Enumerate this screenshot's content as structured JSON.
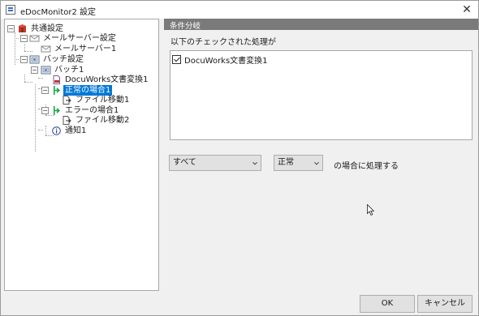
{
  "window": {
    "title": "eDocMonitor2 設定",
    "close_glyph": "✕"
  },
  "tree": {
    "nodes": [
      {
        "label": "共通設定",
        "icon": "settings-box-icon"
      },
      {
        "label": "メールサーバー設定",
        "icon": "mail-icon"
      },
      {
        "label": "メールサーバー1",
        "icon": "mail-icon"
      },
      {
        "label": "バッチ設定",
        "icon": "batch-icon"
      },
      {
        "label": "バッチ1",
        "icon": "batch-icon"
      },
      {
        "label": "DocuWorks文書変換1",
        "icon": "document-convert-icon"
      },
      {
        "label": "正常の場合1",
        "icon": "green-branch-icon",
        "selected": true
      },
      {
        "label": "ファイル移動1",
        "icon": "file-move-icon"
      },
      {
        "label": "エラーの場合1",
        "icon": "green-branch-icon"
      },
      {
        "label": "ファイル移動2",
        "icon": "file-move-icon"
      },
      {
        "label": "通知1",
        "icon": "info-icon"
      }
    ]
  },
  "pane": {
    "header": "条件分岐",
    "description": "以下のチェックされた処理が",
    "list_items": [
      {
        "label": "DocuWorks文書変換1",
        "checked": true
      }
    ],
    "select_scope": "すべて",
    "select_status": "正常",
    "suffix": "の場合に処理する"
  },
  "buttons": {
    "ok": "OK",
    "cancel": "キャンセル"
  },
  "colors": {
    "selection": "#0078d7",
    "header": "#7a7a7a",
    "branch_green": "#1aa34a"
  }
}
